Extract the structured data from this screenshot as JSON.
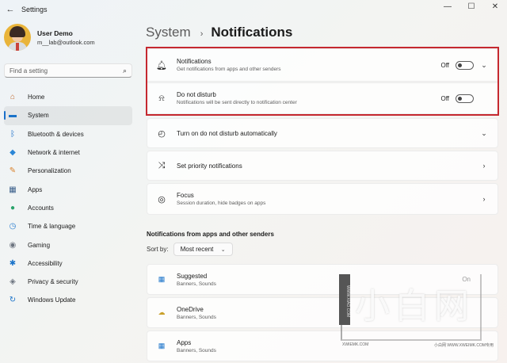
{
  "window": {
    "title": "Settings",
    "back_glyph": "←",
    "minimize_glyph": "—",
    "maximize_glyph": "☐",
    "close_glyph": "✕"
  },
  "user": {
    "name": "User Demo",
    "email": "m__lab@outlook.com"
  },
  "search": {
    "placeholder": "Find a setting",
    "icon": "search-icon"
  },
  "sidebar": {
    "items": [
      {
        "label": "Home",
        "icon": "home-icon",
        "glyph": "⌂",
        "color": "#c0662d",
        "active": false
      },
      {
        "label": "System",
        "icon": "system-icon",
        "glyph": "▬",
        "color": "#1a73c9",
        "active": true
      },
      {
        "label": "Bluetooth & devices",
        "icon": "bluetooth-icon",
        "glyph": "ᛒ",
        "color": "#1a6fc9",
        "active": false
      },
      {
        "label": "Network & internet",
        "icon": "wifi-icon",
        "glyph": "◆",
        "color": "#2b86d6",
        "active": false
      },
      {
        "label": "Personalization",
        "icon": "brush-icon",
        "glyph": "✎",
        "color": "#d9822b",
        "active": false
      },
      {
        "label": "Apps",
        "icon": "apps-icon",
        "glyph": "▦",
        "color": "#3a5f8a",
        "active": false
      },
      {
        "label": "Accounts",
        "icon": "accounts-icon",
        "glyph": "●",
        "color": "#2aa36a",
        "active": false
      },
      {
        "label": "Time & language",
        "icon": "time-language-icon",
        "glyph": "◷",
        "color": "#2b7fd0",
        "active": false
      },
      {
        "label": "Gaming",
        "icon": "gaming-icon",
        "glyph": "◉",
        "color": "#6d7580",
        "active": false
      },
      {
        "label": "Accessibility",
        "icon": "accessibility-icon",
        "glyph": "✱",
        "color": "#1a73c9",
        "active": false
      },
      {
        "label": "Privacy & security",
        "icon": "shield-icon",
        "glyph": "◈",
        "color": "#6d7580",
        "active": false
      },
      {
        "label": "Windows Update",
        "icon": "update-icon",
        "glyph": "↻",
        "color": "#1a73c9",
        "active": false
      }
    ]
  },
  "breadcrumb": {
    "parent": "System",
    "separator": "›",
    "current": "Notifications"
  },
  "settings": {
    "notifications": {
      "title": "Notifications",
      "subtitle": "Get notifications from apps and other senders",
      "state": "Off",
      "icon": "bell-icon",
      "glyph": "🔔︎",
      "chevron": "⌄"
    },
    "dnd": {
      "title": "Do not disturb",
      "subtitle": "Notifications will be sent directly to notification center",
      "state": "Off",
      "icon": "bell-snooze-icon",
      "glyph": "⍾"
    },
    "auto_dnd": {
      "title": "Turn on do not disturb automatically",
      "icon": "clock-icon",
      "glyph": "◴",
      "chevron": "⌄"
    },
    "priority": {
      "title": "Set priority notifications",
      "icon": "priority-icon",
      "glyph": "⤨",
      "chevron": "›"
    },
    "focus": {
      "title": "Focus",
      "subtitle": "Session duration, hide badges on apps",
      "icon": "focus-icon",
      "glyph": "◎",
      "chevron": "›"
    }
  },
  "apps_section": {
    "title": "Notifications from apps and other senders",
    "sort_label": "Sort by:",
    "sort_value": "Most recent",
    "sort_chevron": "⌄",
    "apps": [
      {
        "name": "Suggested",
        "detail": "Banners, Sounds",
        "icon": "suggested-icon",
        "glyph": "▦",
        "color": "#1a73c9",
        "state": "On"
      },
      {
        "name": "OneDrive",
        "detail": "Banners, Sounds",
        "icon": "onedrive-icon",
        "glyph": "☁",
        "color": "#c9a02a",
        "state": ""
      },
      {
        "name": "Apps",
        "detail": "Banners, Sounds",
        "icon": "apps-icon",
        "glyph": "▦",
        "color": "#1a73c9",
        "state": ""
      }
    ]
  },
  "watermark": {
    "big_text": "小白网",
    "side_text": "WWW.XIAO.COM",
    "small_left": "XWIEMK.COM",
    "small_right": "小白网 WWW.XWEIMK.COM专用"
  }
}
